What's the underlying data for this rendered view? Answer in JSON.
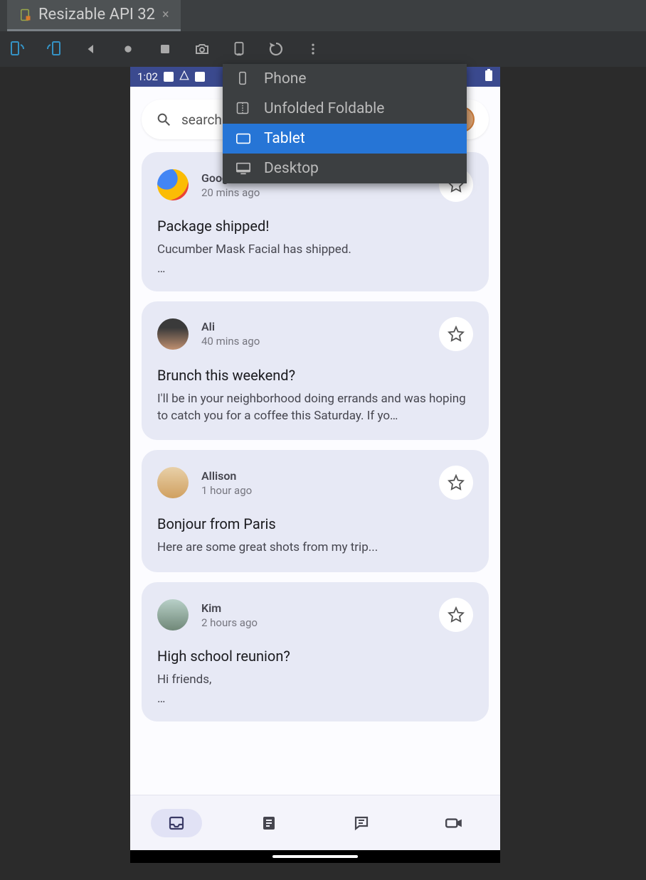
{
  "tab": {
    "title": "Resizable API 32"
  },
  "statusbar": {
    "time": "1:02"
  },
  "search": {
    "placeholder": "search"
  },
  "dropdown": {
    "items": [
      {
        "label": "Phone",
        "selected": false
      },
      {
        "label": "Unfolded Foldable",
        "selected": false
      },
      {
        "label": "Tablet",
        "selected": true
      },
      {
        "label": "Desktop",
        "selected": false
      }
    ]
  },
  "messages": [
    {
      "sender": "Google",
      "time": "20 mins ago",
      "title": "Package shipped!",
      "body": "Cucumber Mask Facial has shipped.",
      "ellipsis": "…",
      "avatar": "google"
    },
    {
      "sender": "Ali",
      "time": "40 mins ago",
      "title": "Brunch this weekend?",
      "body": "I'll be in your neighborhood doing errands and was hoping to catch you for a coffee this Saturday. If yo…",
      "ellipsis": "",
      "avatar": "ali"
    },
    {
      "sender": "Allison",
      "time": "1 hour ago",
      "title": "Bonjour from Paris",
      "body": "Here are some great shots from my trip...",
      "ellipsis": "",
      "avatar": "allison"
    },
    {
      "sender": "Kim",
      "time": "2 hours ago",
      "title": "High school reunion?",
      "body": "Hi friends,",
      "ellipsis": "…",
      "avatar": "kim"
    }
  ]
}
